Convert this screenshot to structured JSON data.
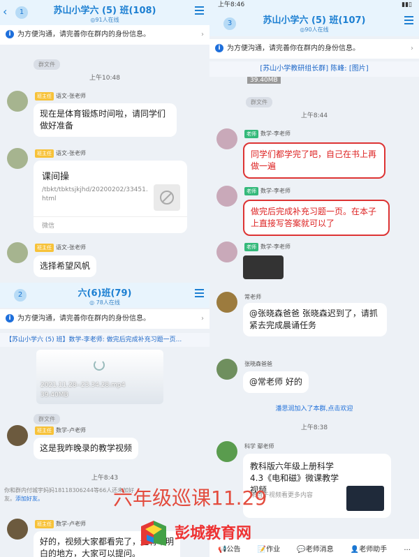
{
  "p1": {
    "badge": "1",
    "title": "苏山小学六 (5) 班(108)",
    "online": "◎91人在线",
    "notice": "为方便沟通，请完善你在群内的身份信息。",
    "file_pill": "群文件",
    "time": "上午10:48",
    "m1": {
      "tag": "班主任",
      "sender": "语文-张老师",
      "text": "现在是体育锻炼时间啦，请同学们做好准备"
    },
    "m2": {
      "tag": "班主任",
      "sender": "语文-张老师",
      "card_title": "课间操",
      "card_url": "/tbkt/tbktsjkjhd/20200202/33451.html",
      "card_src": "微信"
    },
    "m3": {
      "tag": "班主任",
      "sender": "语文-张老师",
      "text": "选择希望风帆"
    }
  },
  "p2": {
    "badge": "2",
    "title": "六(6)班(79)",
    "online": "◎ 78人在线",
    "notice": "为方便沟通，请完善你在群内的身份信息。",
    "banner": "【苏山小学六 (5) 班】数学-李老师: 做完后完成补充习题一页...",
    "video_name": "2021.11.28--23.34.28.mp4",
    "video_size": "39.40MB",
    "file_pill": "群文件",
    "m1": {
      "tag": "班主任",
      "sender": "数学-卢老师",
      "text": "这是我昨晚录的教学视频"
    },
    "time": "上午8:43",
    "sys": "你和群内付城宇妈妈18118306244等66人还未加好友。",
    "sys_link": "添加好友。",
    "m2": {
      "tag": "班主任",
      "sender": "数学-卢老师",
      "text": "好的，视频大家都看完了，还有不明白的地方，大家可以提问。"
    }
  },
  "p3": {
    "statusbar": "上午8:46",
    "badge": "3",
    "title": "苏山小学六 (5) 班(107)",
    "online": "◎90人在线",
    "notice": "为方便沟通，请完善你在群内的身份信息。",
    "banner": "[苏山小学教研组长群] 陈峰: [图片]",
    "size_peek": "39.40MB",
    "file_pill": "群文件",
    "time1": "上午8:44",
    "m1": {
      "tag": "老师",
      "sender": "数学-李老师",
      "text": "同学们都学完了吧，自己在书上再做一遍"
    },
    "m2": {
      "tag": "老师",
      "sender": "数学-李老师",
      "text": "做完后完成补充习题一页。在本子上直接写答案就可以了"
    },
    "m3": {
      "tag": "老师",
      "sender": "数学-李老师"
    },
    "m4": {
      "sender": "常老师",
      "text": "@张晓森爸爸 张晓森迟到了，请抓紧去完成晨诵任务"
    },
    "m5": {
      "sender": "张晓森爸爸",
      "text": "@常老师 好的"
    },
    "join": "潘思润加入了本群,",
    "join_link": "点击欢迎",
    "time2": "上午8:38",
    "m6": {
      "sender": "科学 鄢老师",
      "card_title": "教科版六年级上册科学4.3《电和磁》微课教学视频",
      "card_sub": "来自于视频看更多内容"
    },
    "footer": [
      "公告",
      "作业",
      "老师消息",
      "老师助手",
      "..."
    ]
  },
  "overlay": {
    "title": "六年级巡课11.29",
    "logo": "彭城教育网"
  },
  "colors": {
    "accent": "#1c7fd2",
    "tag_yellow": "#f7c239",
    "tag_green": "#34b97a",
    "alert_red": "#d22"
  }
}
